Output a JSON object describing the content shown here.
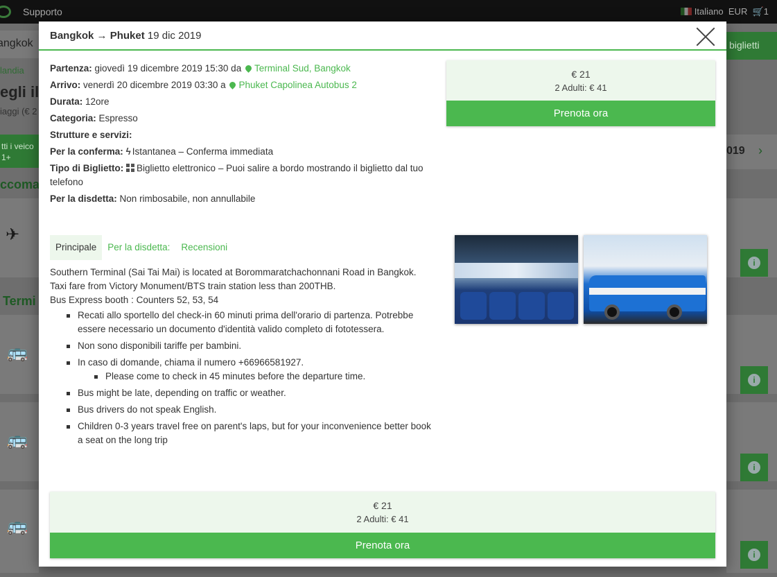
{
  "background": {
    "support_label": "Supporto",
    "language": "Italiano",
    "currency": "EUR",
    "cart_count": "1",
    "search_value": "angkok",
    "tickets_button": "biglietti",
    "breadcrumb": "landia",
    "title_partial": "egli il",
    "subtitle_partial": "iaggi (€ 2",
    "vehicles_partial": "tti i veico",
    "vehicles_sub": "1+",
    "recommended_partial": "ccoma",
    "terminals_partial": "Termi",
    "date_partial": "019"
  },
  "modal": {
    "route_from": "Bangkok",
    "route_arrow": "→",
    "route_to": "Phuket",
    "date": "19 dic 2019",
    "departure_label": "Partenza:",
    "departure_time": "giovedì 19 dicembre 2019 15:30 da",
    "departure_place": "Terminal Sud, Bangkok",
    "arrival_label": "Arrivo:",
    "arrival_time": "venerdì 20 dicembre 2019 03:30 a",
    "arrival_place": "Phuket Capolinea Autobus 2",
    "duration_label": "Durata:",
    "duration": "12ore",
    "category_label": "Categoria:",
    "category": "Espresso",
    "facilities_label": "Strutture e servizi:",
    "confirmation_label": "Per la conferma:",
    "confirmation": "Istantanea – Conferma immediata",
    "ticket_type_label": "Tipo di Biglietto:",
    "ticket_type": "Biglietto elettronico – Puoi salire a bordo mostrando il biglietto dal tuo telefono",
    "cancellation_label": "Per la disdetta:",
    "cancellation": "Non rimbosabile, non annullabile"
  },
  "price": {
    "per_person": "€ 21",
    "total": "2 Adulti: € 41",
    "book_label": "Prenota ora"
  },
  "tabs": [
    "Principale",
    "Per la disdetta:",
    "Recensioni"
  ],
  "description": {
    "line1": "Southern Terminal (Sai Tai Mai) is located at Borommaratchachonnani Road in Bangkok.",
    "line2": "Taxi fare from Victory Monument/BTS train station less than 200THB.",
    "line3": "Bus Express booth : Counters 52, 53, 54",
    "bullets": [
      "Recati allo sportello del check-in 60 minuti prima dell'orario di partenza. Potrebbe essere necessario un documento d'identità valido completo di fototessera.",
      "Non sono disponibili tariffe per bambini.",
      "In caso di domande, chiama il numero +66966581927.",
      "Bus might be late, depending on traffic or weather.",
      "Bus drivers do not speak English.",
      "Children 0-3 years travel free on parent's laps, but for your inconvenience better book a seat on the long trip"
    ],
    "sub_bullet": "Please come to check in 45 minutes before the departure time."
  }
}
